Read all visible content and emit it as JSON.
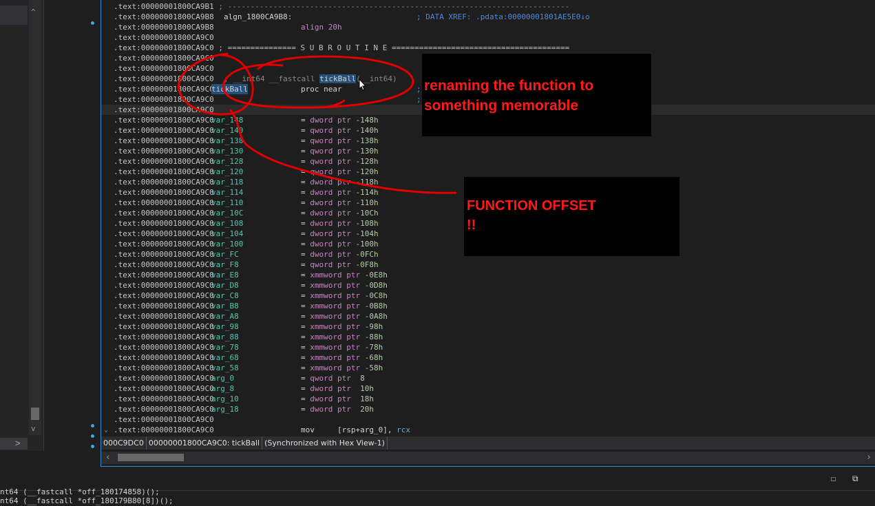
{
  "left_panel": {
    "scroll_up": "^",
    "scroll_down": "v",
    "collapse": ">"
  },
  "code_lines": [
    {
      "addr": ".text:00000001800CA9B1",
      "sep": " ; ---------------------------------------------------------------------------"
    },
    {
      "addr": ".text:00000001800CA9B8",
      "label": "algn_1800CA9B8:",
      "comment": "; DATA XREF: .pdata:00000001801AE5E0↓o"
    },
    {
      "addr": ".text:00000001800CA9B8",
      "op": "align 20h"
    },
    {
      "addr": ".text:00000001800CA9C0",
      "blank": true
    },
    {
      "addr": ".text:00000001800CA9C0",
      "secsep": " ; =============== S U B R O U T I N E ======================================="
    },
    {
      "addr": ".text:00000001800CA9C0",
      "blank": true
    },
    {
      "addr": ".text:00000001800CA9C0",
      "blank": true
    },
    {
      "addr": ".text:00000001800CA9C0",
      "proto_pre": "; __int64 __fastcall ",
      "proto_sel": "tickBall",
      "proto_post": "(__int64)"
    },
    {
      "addr": ".text:00000001800CA9C0",
      "label_sel": "tickBall",
      "procnear": "proc near",
      "comment": ";"
    },
    {
      "addr": ".text:00000001800CA9C0",
      "comment": ";"
    },
    {
      "addr": ".text:00000001800CA9C0",
      "blank": true,
      "highlight": true
    },
    {
      "addr": ".text:00000001800CA9C0",
      "var": "var_148",
      "type": "dword",
      "off": "-148h"
    },
    {
      "addr": ".text:00000001800CA9C0",
      "var": "var_140",
      "type": "qword",
      "off": "-140h"
    },
    {
      "addr": ".text:00000001800CA9C0",
      "var": "var_138",
      "type": "qword",
      "off": "-138h"
    },
    {
      "addr": ".text:00000001800CA9C0",
      "var": "var_130",
      "type": "qword",
      "off": "-130h"
    },
    {
      "addr": ".text:00000001800CA9C0",
      "var": "var_128",
      "type": "qword",
      "off": "-128h"
    },
    {
      "addr": ".text:00000001800CA9C0",
      "var": "var_120",
      "type": "qword",
      "off": "-120h"
    },
    {
      "addr": ".text:00000001800CA9C0",
      "var": "var_118",
      "type": "dword",
      "off": "-118h"
    },
    {
      "addr": ".text:00000001800CA9C0",
      "var": "var_114",
      "type": "dword",
      "off": "-114h"
    },
    {
      "addr": ".text:00000001800CA9C0",
      "var": "var_110",
      "type": "dword",
      "off": "-110h"
    },
    {
      "addr": ".text:00000001800CA9C0",
      "var": "var_10C",
      "type": "dword",
      "off": "-10Ch"
    },
    {
      "addr": ".text:00000001800CA9C0",
      "var": "var_108",
      "type": "dword",
      "off": "-108h"
    },
    {
      "addr": ".text:00000001800CA9C0",
      "var": "var_104",
      "type": "dword",
      "off": "-104h"
    },
    {
      "addr": ".text:00000001800CA9C0",
      "var": "var_100",
      "type": "dword",
      "off": "-100h"
    },
    {
      "addr": ".text:00000001800CA9C0",
      "var": "var_FC",
      "type": "dword",
      "off": "-0FCh"
    },
    {
      "addr": ".text:00000001800CA9C0",
      "var": "var_F8",
      "type": "qword",
      "off": "-0F8h"
    },
    {
      "addr": ".text:00000001800CA9C0",
      "var": "var_E8",
      "type": "xmmword",
      "off": "-0E8h"
    },
    {
      "addr": ".text:00000001800CA9C0",
      "var": "var_D8",
      "type": "xmmword",
      "off": "-0D8h"
    },
    {
      "addr": ".text:00000001800CA9C0",
      "var": "var_C8",
      "type": "xmmword",
      "off": "-0C8h"
    },
    {
      "addr": ".text:00000001800CA9C0",
      "var": "var_B8",
      "type": "xmmword",
      "off": "-0B8h"
    },
    {
      "addr": ".text:00000001800CA9C0",
      "var": "var_A8",
      "type": "xmmword",
      "off": "-0A8h"
    },
    {
      "addr": ".text:00000001800CA9C0",
      "var": "var_98",
      "type": "xmmword",
      "off": "-98h"
    },
    {
      "addr": ".text:00000001800CA9C0",
      "var": "var_88",
      "type": "xmmword",
      "off": "-88h"
    },
    {
      "addr": ".text:00000001800CA9C0",
      "var": "var_78",
      "type": "xmmword",
      "off": "-78h"
    },
    {
      "addr": ".text:00000001800CA9C0",
      "var": "var_68",
      "type": "xmmword",
      "off": "-68h"
    },
    {
      "addr": ".text:00000001800CA9C0",
      "var": "var_58",
      "type": "xmmword",
      "off": "-58h"
    },
    {
      "addr": ".text:00000001800CA9C0",
      "var": "arg_0",
      "type": "qword",
      "off": " 8"
    },
    {
      "addr": ".text:00000001800CA9C0",
      "var": "arg_8",
      "type": "dword",
      "off": " 10h"
    },
    {
      "addr": ".text:00000001800CA9C0",
      "var": "arg_10",
      "type": "dword",
      "off": " 18h"
    },
    {
      "addr": ".text:00000001800CA9C0",
      "var": "arg_18",
      "type": "dword",
      "off": " 20h"
    },
    {
      "addr": ".text:00000001800CA9C0",
      "blank": true
    },
    {
      "addr": ".text:00000001800CA9C0",
      "mov": true,
      "mnem": "mov",
      "arg1": "[rsp+arg_0]",
      "arg2": "rcx"
    }
  ],
  "status_bar": {
    "offset": "000C9DC0",
    "location": "00000001800CA9C0: tickBall",
    "sync": "(Synchronized with Hex View-1)"
  },
  "callouts": {
    "rename_line1": "renaming the function to",
    "rename_line2": "something memorable",
    "offset_line1": "FUNCTION OFFSET",
    "offset_line2": "!!"
  },
  "window_buttons": {
    "restore": "☐",
    "tile": "⧉"
  },
  "bottom_lines": [
    "nt64 (__fastcall *off_180174858)();",
    "nt64 (__fastcall *off_180179B80[8])();"
  ],
  "colors": {
    "accent": "#3a8ad6",
    "annotation": "#ff1a1a",
    "var_color": "#4ec9b0",
    "keyword_color": "#c586c0"
  }
}
